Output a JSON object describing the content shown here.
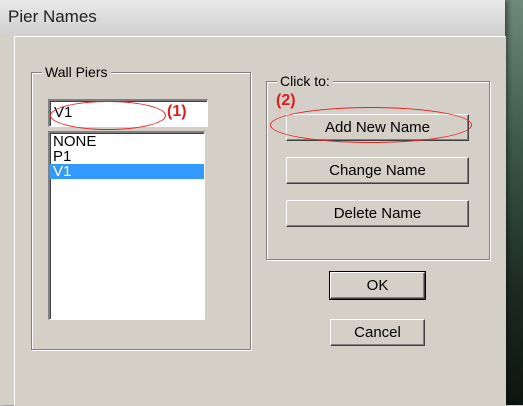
{
  "window": {
    "title": "Pier Names"
  },
  "wall_piers": {
    "legend": "Wall Piers",
    "name_value": "V1",
    "list_items": [
      {
        "label": "NONE",
        "selected": false
      },
      {
        "label": "P1",
        "selected": false
      },
      {
        "label": "V1",
        "selected": true
      }
    ]
  },
  "click_to": {
    "legend": "Click to:",
    "add_label": "Add New Name",
    "change_label": "Change Name",
    "delete_label": "Delete Name"
  },
  "dialog_buttons": {
    "ok_label": "OK",
    "cancel_label": "Cancel"
  },
  "annotations": {
    "step1": "(1)",
    "step2": "(2)",
    "color": "#d81e1e"
  },
  "colors": {
    "selection": "#3399ff",
    "dialog_face": "#d4d0c8"
  }
}
